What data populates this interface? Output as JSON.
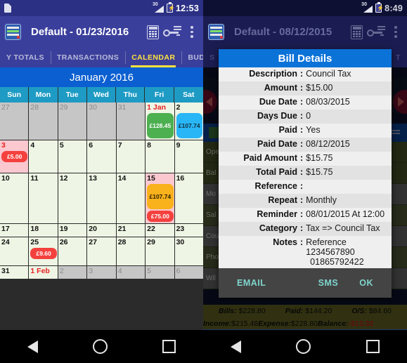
{
  "left": {
    "status": {
      "signal_label": "30",
      "time": "12:53",
      "sd_icon": "sd-card-icon",
      "battery_icon": "battery-charging-icon"
    },
    "appbar": {
      "title": "Default - 01/23/2016",
      "logo_icon": "app-logo-icon",
      "calculator_icon": "calculator-icon",
      "key_icon": "key-icon",
      "overflow_icon": "overflow-menu-icon"
    },
    "tabs": [
      {
        "label": "Y TOTALS",
        "active": false
      },
      {
        "label": "TRANSACTIONS",
        "active": false
      },
      {
        "label": "CALENDAR",
        "active": true
      },
      {
        "label": "BUDGET",
        "active": false
      }
    ],
    "calendar": {
      "month_title": "January 2016",
      "weekdays": [
        "Sun",
        "Mon",
        "Tue",
        "Wed",
        "Thu",
        "Fri",
        "Sat"
      ],
      "weeks": [
        [
          {
            "day": "27",
            "out": true
          },
          {
            "day": "28",
            "out": true
          },
          {
            "day": "29",
            "out": true
          },
          {
            "day": "30",
            "out": true
          },
          {
            "day": "31",
            "out": true
          },
          {
            "day": "1 Jan",
            "red": true,
            "chips": [
              {
                "text": "£128.45",
                "color": "green"
              }
            ]
          },
          {
            "day": "2",
            "chips": [
              {
                "text": "£107.74",
                "color": "cyan"
              }
            ]
          }
        ],
        [
          {
            "day": "3",
            "red": true,
            "pink": true,
            "chips": [
              {
                "text": "£5.00",
                "color": "red"
              }
            ]
          },
          {
            "day": "4"
          },
          {
            "day": "5"
          },
          {
            "day": "6"
          },
          {
            "day": "7"
          },
          {
            "day": "8"
          },
          {
            "day": "9"
          }
        ],
        [
          {
            "day": "10"
          },
          {
            "day": "11"
          },
          {
            "day": "12"
          },
          {
            "day": "13"
          },
          {
            "day": "14"
          },
          {
            "day": "15",
            "pink": true,
            "chips": [
              {
                "text": "£107.74",
                "color": "amber"
              },
              {
                "text": "£75.00",
                "color": "red"
              }
            ]
          },
          {
            "day": "16"
          }
        ],
        [
          {
            "day": "17"
          },
          {
            "day": "18"
          },
          {
            "day": "19"
          },
          {
            "day": "20"
          },
          {
            "day": "21"
          },
          {
            "day": "22"
          },
          {
            "day": "23"
          }
        ],
        [
          {
            "day": "24"
          },
          {
            "day": "25",
            "chips": [
              {
                "text": "£9.60",
                "color": "red"
              }
            ]
          },
          {
            "day": "26"
          },
          {
            "day": "27"
          },
          {
            "day": "28"
          },
          {
            "day": "29"
          },
          {
            "day": "30"
          }
        ],
        [
          {
            "day": "31"
          },
          {
            "day": "1 Feb",
            "red": true
          },
          {
            "day": "2",
            "out": true
          },
          {
            "day": "3",
            "out": true
          },
          {
            "day": "4",
            "out": true
          },
          {
            "day": "5",
            "out": true
          },
          {
            "day": "6",
            "out": true
          }
        ]
      ]
    }
  },
  "right": {
    "status": {
      "signal_label": "30",
      "time": "8:49"
    },
    "appbar": {
      "title": "Default - 08/12/2015"
    },
    "tabs": [
      {
        "label": "S"
      },
      {
        "label": "T"
      }
    ],
    "dialog": {
      "title": "Bill Details",
      "fields": [
        {
          "label": "Description",
          "value": "Council Tax"
        },
        {
          "label": "Amount",
          "value": "$15.00"
        },
        {
          "label": "Due Date",
          "value": "08/03/2015"
        },
        {
          "label": "Days Due",
          "value": "0"
        },
        {
          "label": "Paid",
          "value": "Yes"
        },
        {
          "label": "Paid Date",
          "value": "08/12/2015"
        },
        {
          "label": "Paid Amount",
          "value": "$15.75"
        },
        {
          "label": "Total Paid",
          "value": "$15.75"
        },
        {
          "label": "Reference",
          "value": ""
        },
        {
          "label": "Repeat",
          "value": "Monthly"
        },
        {
          "label": "Reminder",
          "value": "08/01/2015 At 12:00"
        },
        {
          "label": "Category",
          "value": "Tax => Council Tax"
        }
      ],
      "notes": {
        "label": "Notes",
        "line1": "Reference 1234567890",
        "line2": "01865792422"
      },
      "actions": {
        "email": "EMAIL",
        "sms": "SMS",
        "ok": "OK"
      }
    },
    "background_rows": [
      "Ope",
      "Bal",
      "Mo",
      "Sal",
      "Cou",
      "Pho",
      "Wil"
    ],
    "summary": {
      "bills_label": "Bills:",
      "bills_value": "$228.80",
      "paid_label": "Paid:",
      "paid_value": "$144.20",
      "os_label": "O/S:",
      "os_value": "$84.60",
      "income_label": "Income:",
      "income_value": "$215.48",
      "expense_label": "Expense:",
      "expense_value": "$228.80",
      "balance_label": "Balance:",
      "balance_value": "-$13.32"
    }
  },
  "navbar": {
    "back_icon": "back-triangle-icon",
    "home_icon": "home-circle-icon",
    "recents_icon": "recents-square-icon"
  }
}
